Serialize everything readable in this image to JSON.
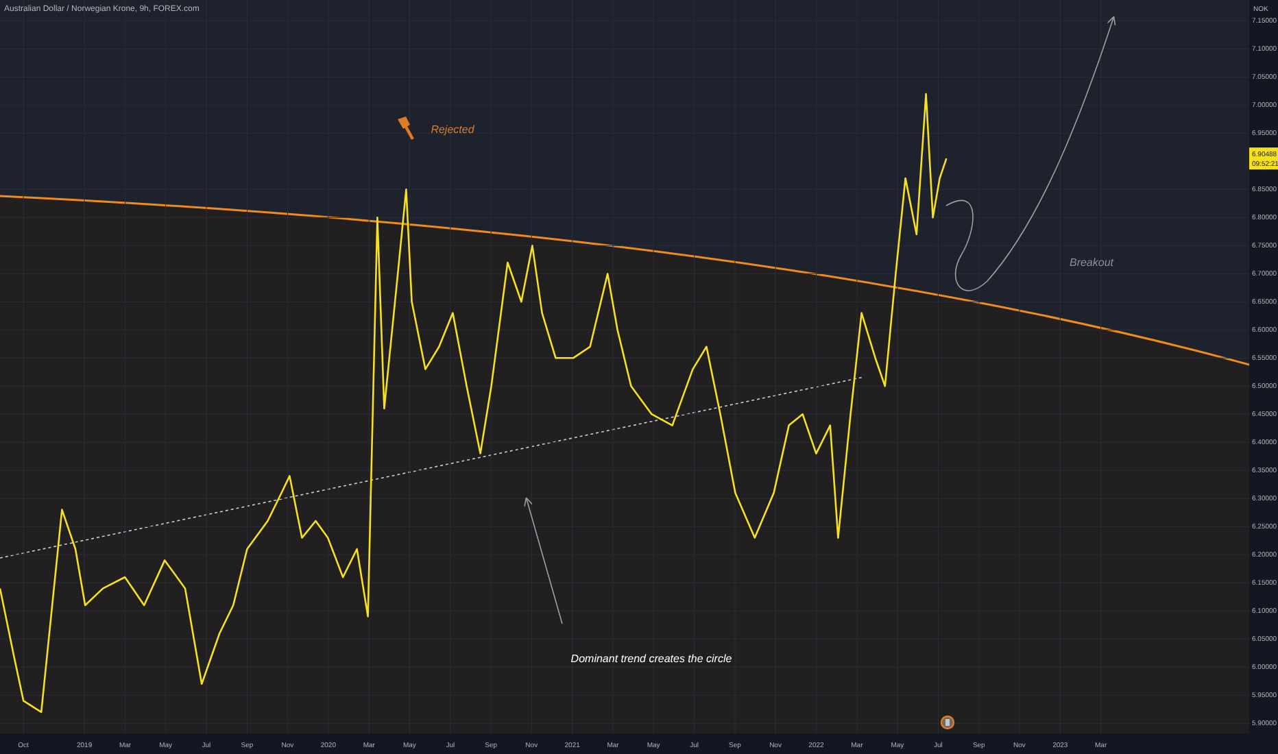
{
  "title": "Australian Dollar / Norwegian Krone, 9h, FOREX.com",
  "chart": {
    "currency": "NOK",
    "price_label": {
      "value": "6.90488",
      "countdown": "09:52:21"
    },
    "chart_data": {
      "type": "line",
      "x": [
        2018.654,
        2018.711,
        2018.75,
        2018.823,
        2018.908,
        2018.963,
        2019.003,
        2019.076,
        2019.166,
        2019.245,
        2019.329,
        2019.413,
        2019.481,
        2019.554,
        2019.61,
        2019.667,
        2019.751,
        2019.808,
        2019.841,
        2019.892,
        2019.948,
        2019.998,
        2020.06,
        2020.117,
        2020.162,
        2020.201,
        2020.229,
        2020.285,
        2020.319,
        2020.342,
        2020.398,
        2020.454,
        2020.51,
        2020.567,
        2020.623,
        2020.668,
        2020.735,
        2020.791,
        2020.836,
        2020.876,
        2020.932,
        2021.005,
        2021.073,
        2021.145,
        2021.185,
        2021.241,
        2021.325,
        2021.41,
        2021.494,
        2021.55,
        2021.607,
        2021.668,
        2021.748,
        2021.826,
        2021.888,
        2021.944,
        2022.0,
        2022.057,
        2022.09,
        2022.141,
        2022.186,
        2022.242,
        2022.282,
        2022.326,
        2022.366,
        2022.411,
        2022.45,
        2022.478,
        2022.506,
        2022.534
      ],
      "series": [
        {
          "color": "#f7e01d",
          "values": [
            6.14,
            6.02,
            5.94,
            5.92,
            6.28,
            6.21,
            6.11,
            6.14,
            6.16,
            6.11,
            6.19,
            6.14,
            5.97,
            6.06,
            6.11,
            6.21,
            6.26,
            6.31,
            6.34,
            6.23,
            6.26,
            6.23,
            6.16,
            6.21,
            6.09,
            6.8,
            6.46,
            6.7,
            6.85,
            6.65,
            6.53,
            6.57,
            6.63,
            6.5,
            6.38,
            6.5,
            6.72,
            6.65,
            6.75,
            6.63,
            6.55,
            6.55,
            6.57,
            6.7,
            6.6,
            6.5,
            6.45,
            6.43,
            6.53,
            6.57,
            6.45,
            6.31,
            6.23,
            6.31,
            6.43,
            6.45,
            6.38,
            6.43,
            6.23,
            6.45,
            6.63,
            6.55,
            6.5,
            6.7,
            6.87,
            6.77,
            7.02,
            6.8,
            6.87,
            6.905
          ]
        }
      ],
      "grid": true,
      "xlim": [
        2018.654,
        2023.775
      ],
      "ylim": [
        5.882,
        7.187
      ],
      "xticks": [
        {
          "value": 2018.75,
          "label": "Oct"
        },
        2019,
        {
          "value": 2019.167,
          "label": "Mar"
        },
        {
          "value": 2019.333,
          "label": "May"
        },
        {
          "value": 2019.5,
          "label": "Jul"
        },
        {
          "value": 2019.667,
          "label": "Sep"
        },
        {
          "value": 2019.833,
          "label": "Nov"
        },
        2020,
        {
          "value": 2020.167,
          "label": "Mar"
        },
        {
          "value": 2020.333,
          "label": "May"
        },
        {
          "value": 2020.5,
          "label": "Jul"
        },
        {
          "value": 2020.667,
          "label": "Sep"
        },
        {
          "value": 2020.833,
          "label": "Nov"
        },
        2021,
        {
          "value": 2021.167,
          "label": "Mar"
        },
        {
          "value": 2021.333,
          "label": "May"
        },
        {
          "value": 2021.5,
          "label": "Jul"
        },
        {
          "value": 2021.667,
          "label": "Sep"
        },
        {
          "value": 2021.833,
          "label": "Nov"
        },
        2022,
        {
          "value": 2022.167,
          "label": "Mar"
        },
        {
          "value": 2022.333,
          "label": "May"
        },
        {
          "value": 2022.5,
          "label": "Jul"
        },
        {
          "value": 2022.667,
          "label": "Sep"
        },
        {
          "value": 2022.833,
          "label": "Nov"
        },
        2023,
        {
          "value": 2023.167,
          "label": "Mar"
        }
      ],
      "yticks": [
        {
          "value": 7.15,
          "label": "7.15000"
        },
        {
          "value": 7.1,
          "label": "7.10000"
        },
        {
          "value": 7.05,
          "label": "7.05000"
        },
        {
          "value": 7.0,
          "label": "7.00000"
        },
        {
          "value": 6.95,
          "label": "6.95000"
        },
        {
          "value": 6.85,
          "label": "6.85000"
        },
        {
          "value": 6.8,
          "label": "6.80000"
        },
        {
          "value": 6.75,
          "label": "6.75000"
        },
        {
          "value": 6.7,
          "label": "6.70000"
        },
        {
          "value": 6.65,
          "label": "6.65000"
        },
        {
          "value": 6.6,
          "label": "6.60000"
        },
        {
          "value": 6.55,
          "label": "6.55000"
        },
        {
          "value": 6.5,
          "label": "6.50000"
        },
        {
          "value": 6.45,
          "label": "6.45000"
        },
        {
          "value": 6.4,
          "label": "6.40000"
        },
        {
          "value": 6.35,
          "label": "6.35000"
        },
        {
          "value": 6.3,
          "label": "6.30000"
        },
        {
          "value": 6.25,
          "label": "6.25000"
        },
        {
          "value": 6.2,
          "label": "6.20000"
        },
        {
          "value": 6.15,
          "label": "6.15000"
        },
        {
          "value": 6.1,
          "label": "6.10000"
        },
        {
          "value": 6.05,
          "label": "6.05000"
        },
        {
          "value": 6.0,
          "label": "6.00000"
        },
        {
          "value": 5.95,
          "label": "5.95000"
        },
        {
          "value": 5.9,
          "label": "5.90000"
        }
      ],
      "annotations": [
        "Rejected",
        "Breakout",
        "Dominant trend creates the circle"
      ]
    }
  }
}
